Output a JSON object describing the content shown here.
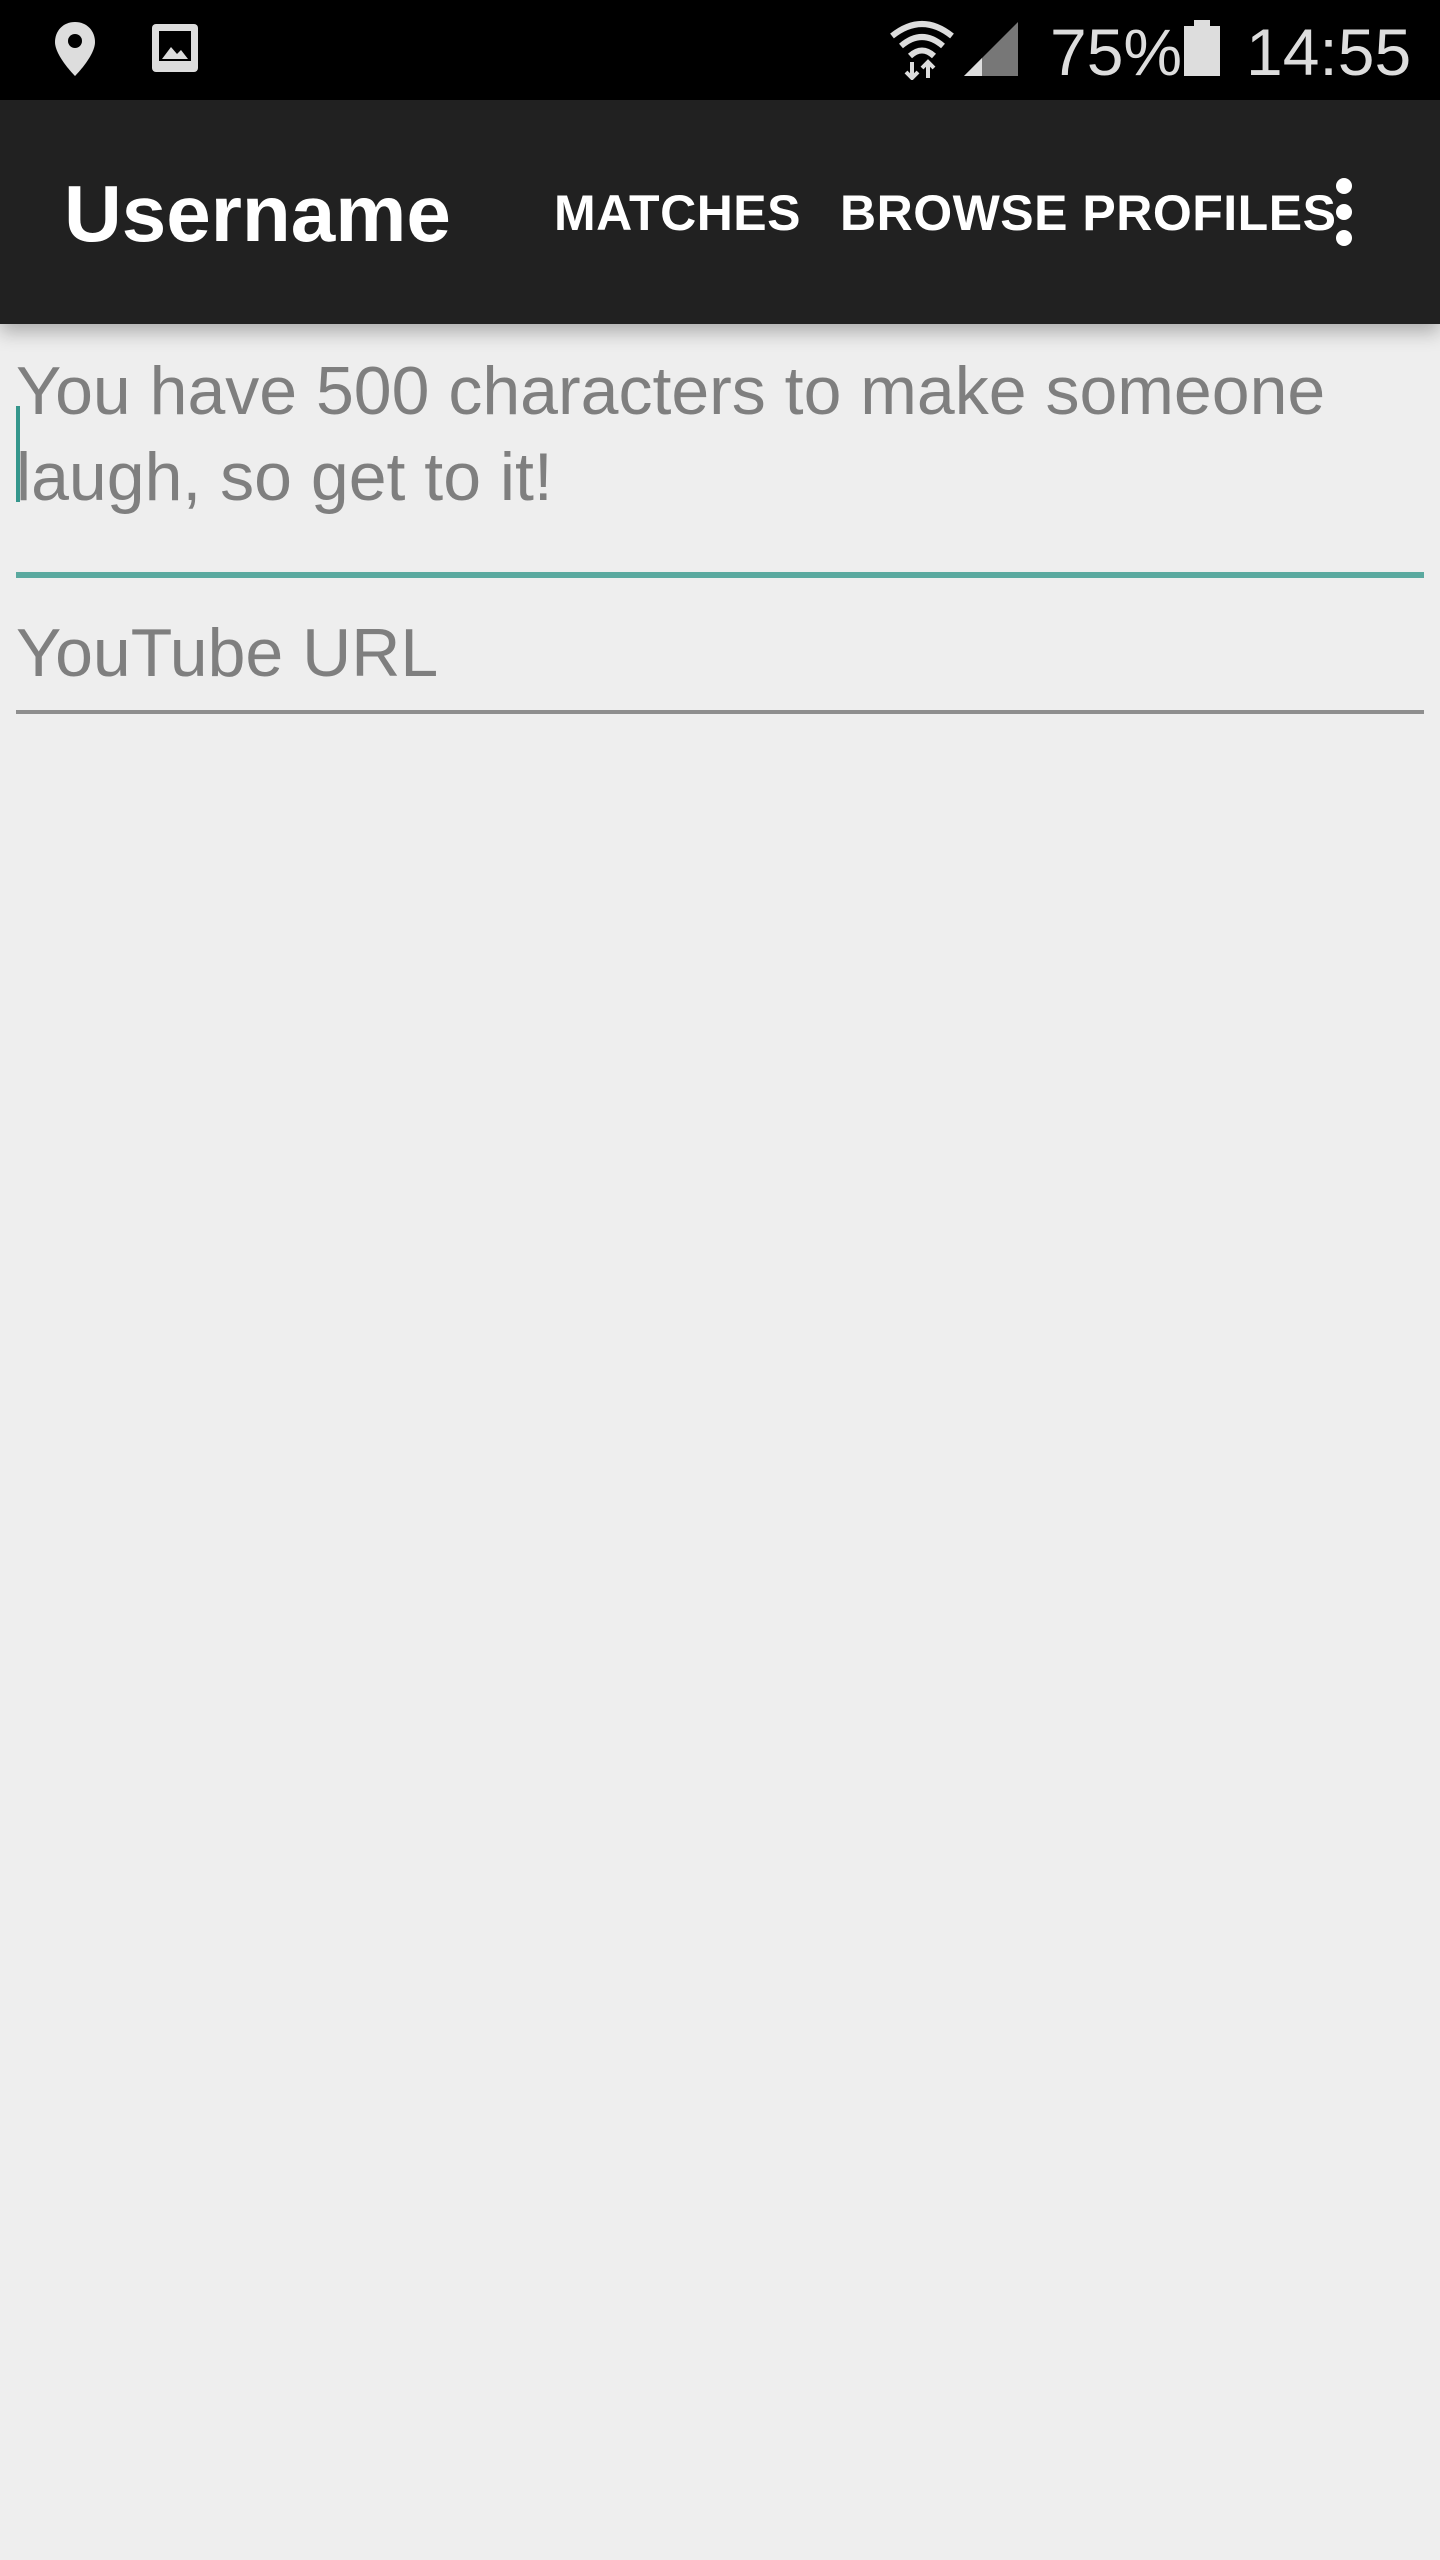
{
  "status_bar": {
    "battery_percent": "75%",
    "time": "14:55",
    "icons": [
      "location-icon",
      "gallery-icon",
      "wifi-icon",
      "signal-icon",
      "battery-icon"
    ]
  },
  "app_bar": {
    "title": "Username",
    "actions": {
      "matches": "MATCHES",
      "browse_profiles": "BROWSE PROFILES"
    },
    "overflow_icon": "more-vert-icon"
  },
  "form": {
    "message_placeholder": "You have 500 characters to make someone laugh, so get to it!",
    "youtube_placeholder": "YouTube URL"
  },
  "colors": {
    "status_bar_bg": "#000000",
    "app_bar_bg": "#212121",
    "page_bg": "#eeeeee",
    "accent": "#5aa99f",
    "hint_text": "#7f7f7f"
  }
}
